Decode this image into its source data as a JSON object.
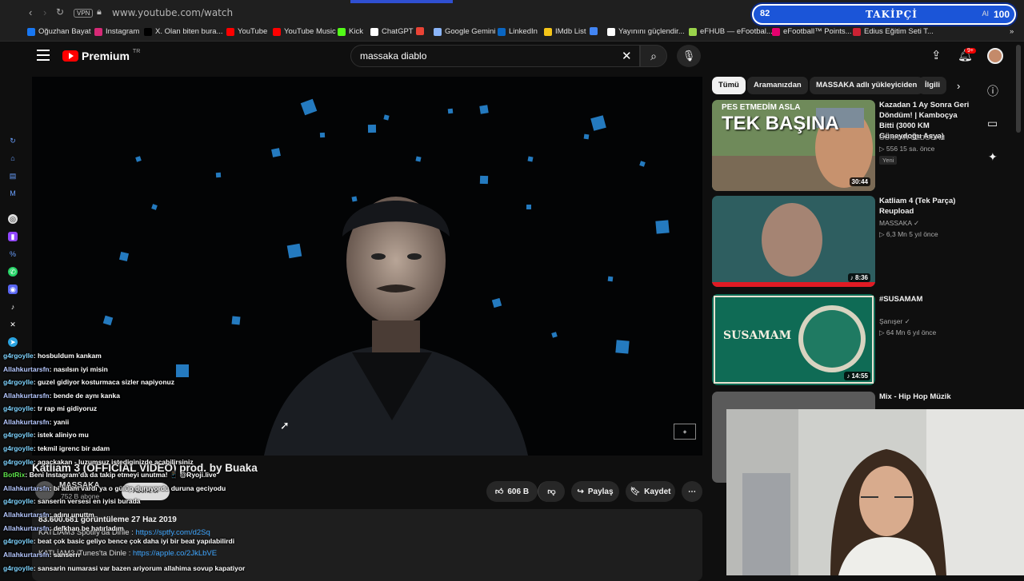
{
  "browser": {
    "url": "www.youtube.com/watch",
    "vpn": "VPN",
    "bookmarks": [
      {
        "label": "Oğuzhan Bayat",
        "color": "#1877f2"
      },
      {
        "label": "Instagram",
        "color": "#d62976"
      },
      {
        "label": "X. Olan biten bura...",
        "color": "#000000"
      },
      {
        "label": "YouTube",
        "color": "#ff0000"
      },
      {
        "label": "YouTube Music",
        "color": "#ff0000"
      },
      {
        "label": "Kick",
        "color": "#53fc18"
      },
      {
        "label": "ChatGPT",
        "color": "#ffffff"
      },
      {
        "label": "",
        "color": "#ea4335"
      },
      {
        "label": "Google Gemini",
        "color": "#8ab4f8"
      },
      {
        "label": "LinkedIn",
        "color": "#0a66c2"
      },
      {
        "label": "IMdb List",
        "color": "#f5c518"
      },
      {
        "label": "",
        "color": "#4285f4"
      },
      {
        "label": "Yayınını güçlendir...",
        "color": "#ffffff"
      },
      {
        "label": "eFHUB — eFootbal...",
        "color": "#9ad34b"
      },
      {
        "label": "eFootball™ Points...",
        "color": "#e5006e"
      },
      {
        "label": "Edius Eğitim Seti T...",
        "color": "#cc2233"
      }
    ]
  },
  "overlay": {
    "follower_count": "82",
    "follower_label": "TAKİPÇİ",
    "follower_goal": "100",
    "ai_label": "AI"
  },
  "header": {
    "brand": "Premium",
    "brand_sup": "TR",
    "search_value": "massaka diablo",
    "notif_badge": "9+"
  },
  "video": {
    "title": "Katliam 3 (OFFICIAL VIDEO) prod. by Buaka",
    "channel": "MASSAKA",
    "subscribers": "752 B abone",
    "subscribe_label": "Abone ol",
    "likes": "606 B",
    "share": "Paylaş",
    "save": "Kaydet",
    "views_date": "83.600.681 görüntüleme  27 Haz 2019",
    "desc_lines": [
      {
        "text": "KATLİAM3 Spotify'da Dinle : ",
        "link": "https://sptfy.com/d2Sq"
      },
      {
        "text": "KATLİAM3 iTunes'ta Dinle : ",
        "link": "https://apple.co/2JkLbVE"
      }
    ]
  },
  "chat": [
    {
      "user": "g4rgoylle",
      "type": "u1",
      "msg": ": hosbuldum kankam"
    },
    {
      "user": "Allahkurtarsfn",
      "type": "u2",
      "msg": ": nasılsın iyi misin"
    },
    {
      "user": "g4rgoylle",
      "type": "u1",
      "msg": ": guzel gidiyor kosturmaca sizler napiyonuz"
    },
    {
      "user": "Allahkurtarsfn",
      "type": "u2",
      "msg": ": bende de aynı kanka"
    },
    {
      "user": "g4rgoylle",
      "type": "u1",
      "msg": ": tr rap mi gidiyoruz"
    },
    {
      "user": "Allahkurtarsfn",
      "type": "u2",
      "msg": ": yanii"
    },
    {
      "user": "g4rgoylle",
      "type": "u1",
      "msg": ": istek aliniyo mu"
    },
    {
      "user": "g4rgoylle",
      "type": "u1",
      "msg": ": tekmil igrenc bir adam"
    },
    {
      "user": "g4rgoylle",
      "type": "u1",
      "msg": ": agackakan - luzumsuz istediginizde acabilirsiniz"
    },
    {
      "user": "BotRix",
      "type": "bot",
      "msg": ": Beni Instagram'da da takip etmeyi unutma! 📱 @Ryoji.live"
    },
    {
      "user": "Allahkurtarsfn",
      "type": "u2",
      "msg": ": bi adam vardı ya o gülüp duruyordu duruna geciyodu"
    },
    {
      "user": "g4rgoylle",
      "type": "u1",
      "msg": ": sanserin versesi en iyisi burada"
    },
    {
      "user": "Allahkurtarsfn",
      "type": "u2",
      "msg": ": adını unuttm"
    },
    {
      "user": "Allahkurtarsfn",
      "type": "u2",
      "msg": ": defkhan be hatırladım"
    },
    {
      "user": "g4rgoylle",
      "type": "u1",
      "msg": ": beat çok basic geliyo bence çok daha iyi bir beat yapılabilirdi"
    },
    {
      "user": "Allahkurtarsfn",
      "type": "u2",
      "msg": ": sanserrr"
    },
    {
      "user": "g4rgoylle",
      "type": "u1",
      "msg": ": sansarin numarasi var bazen ariyorum allahima sovup kapatiyor"
    }
  ],
  "chips": [
    "Tümü",
    "Aramanızdan",
    "MASSAKA adlı yükleyiciden",
    "İlgili"
  ],
  "recommended": [
    {
      "thumb_text": "PES ETMEDİM ASLA",
      "thumb_big": "TEK BAŞINA",
      "duration": "30:44",
      "title": "Kazadan 1 Ay Sonra Geri Döndüm! | Kamboçya Bitti (3000 KM Güneydoğu Asya)",
      "channel": "GÖKHAN ÖZDOĞAN",
      "stats": "▷ 556  15 sa. önce",
      "badge": "Yeni"
    },
    {
      "thumb_text": "",
      "thumb_big": "",
      "duration": "♪ 8:36",
      "title": "Katliam 4 (Tek Parça) Reupload",
      "channel": "MASSAKA ✓",
      "stats": "▷ 6,3 Mn  5 yıl önce",
      "badge": ""
    },
    {
      "thumb_text": "",
      "thumb_big": "SUSAMAM",
      "duration": "♪ 14:55",
      "title": "#SUSAMAM",
      "channel": "Şanışer ✓",
      "stats": "▷ 64 Mn  6 yıl önce",
      "badge": ""
    },
    {
      "thumb_text": "",
      "thumb_big": "",
      "duration": "",
      "title": "Mix - Hip Hop Müzik",
      "channel": "",
      "stats": "",
      "badge": ""
    }
  ],
  "colors": {
    "accent": "#ff0000",
    "link": "#3ea6ff",
    "overlay": "#1b55d8"
  }
}
